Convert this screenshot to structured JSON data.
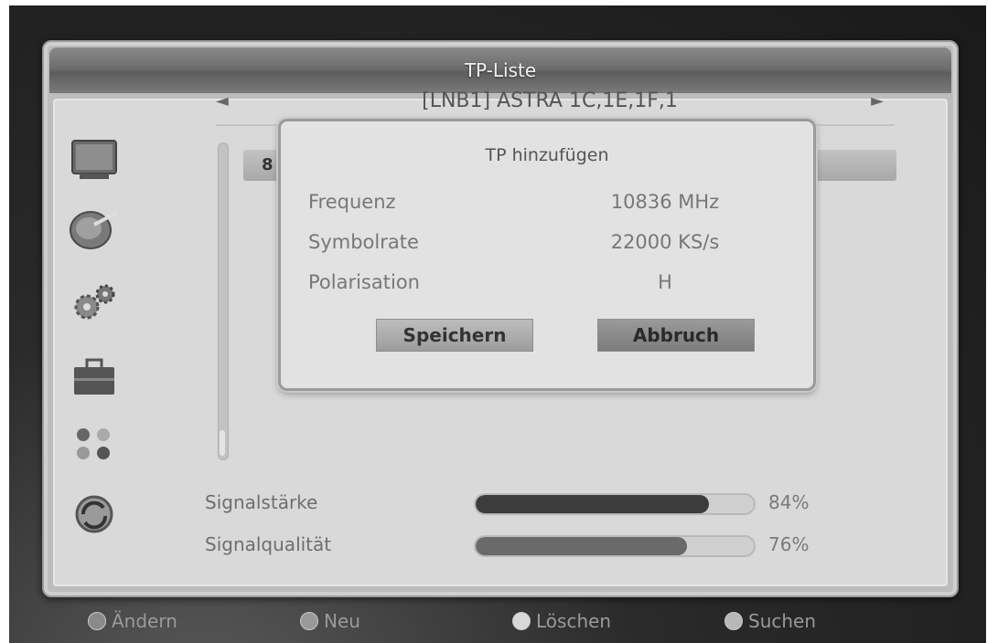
{
  "window": {
    "title": "TP-Liste"
  },
  "satellite": {
    "name": "[LNB1] ASTRA 1C,1E,1F,1",
    "prev_arrow": "◄",
    "next_arrow": "►"
  },
  "list": {
    "visible_row_start": "8"
  },
  "sidebar": {
    "icons": [
      "tv-icon",
      "satellite-dish-icon",
      "settings-gears-icon",
      "toolbox-icon",
      "games-icon",
      "system-cycle-icon"
    ]
  },
  "dialog": {
    "title": "TP hinzufügen",
    "rows": [
      {
        "label": "Frequenz",
        "value": "10836 MHz"
      },
      {
        "label": "Symbolrate",
        "value": "22000 KS/s"
      },
      {
        "label": "Polarisation",
        "value": "H"
      }
    ],
    "save_label": "Speichern",
    "cancel_label": "Abbruch"
  },
  "signal": {
    "strength_label": "Signalstärke",
    "strength_percent": "84%",
    "strength_value": 84,
    "quality_label": "Signalqualität",
    "quality_percent": "76%",
    "quality_value": 76
  },
  "footer": {
    "edit_label": "Ändern",
    "new_label": "Neu",
    "delete_label": "Löschen",
    "search_label": "Suchen"
  },
  "colors": {
    "strength_fill": "#3c3c3c",
    "quality_fill": "#6a6a6a",
    "footer_red": "#8a8a8a",
    "footer_green": "#9a9a9a",
    "footer_yellow": "#d8d8d8",
    "footer_blue": "#b8b8b8"
  }
}
